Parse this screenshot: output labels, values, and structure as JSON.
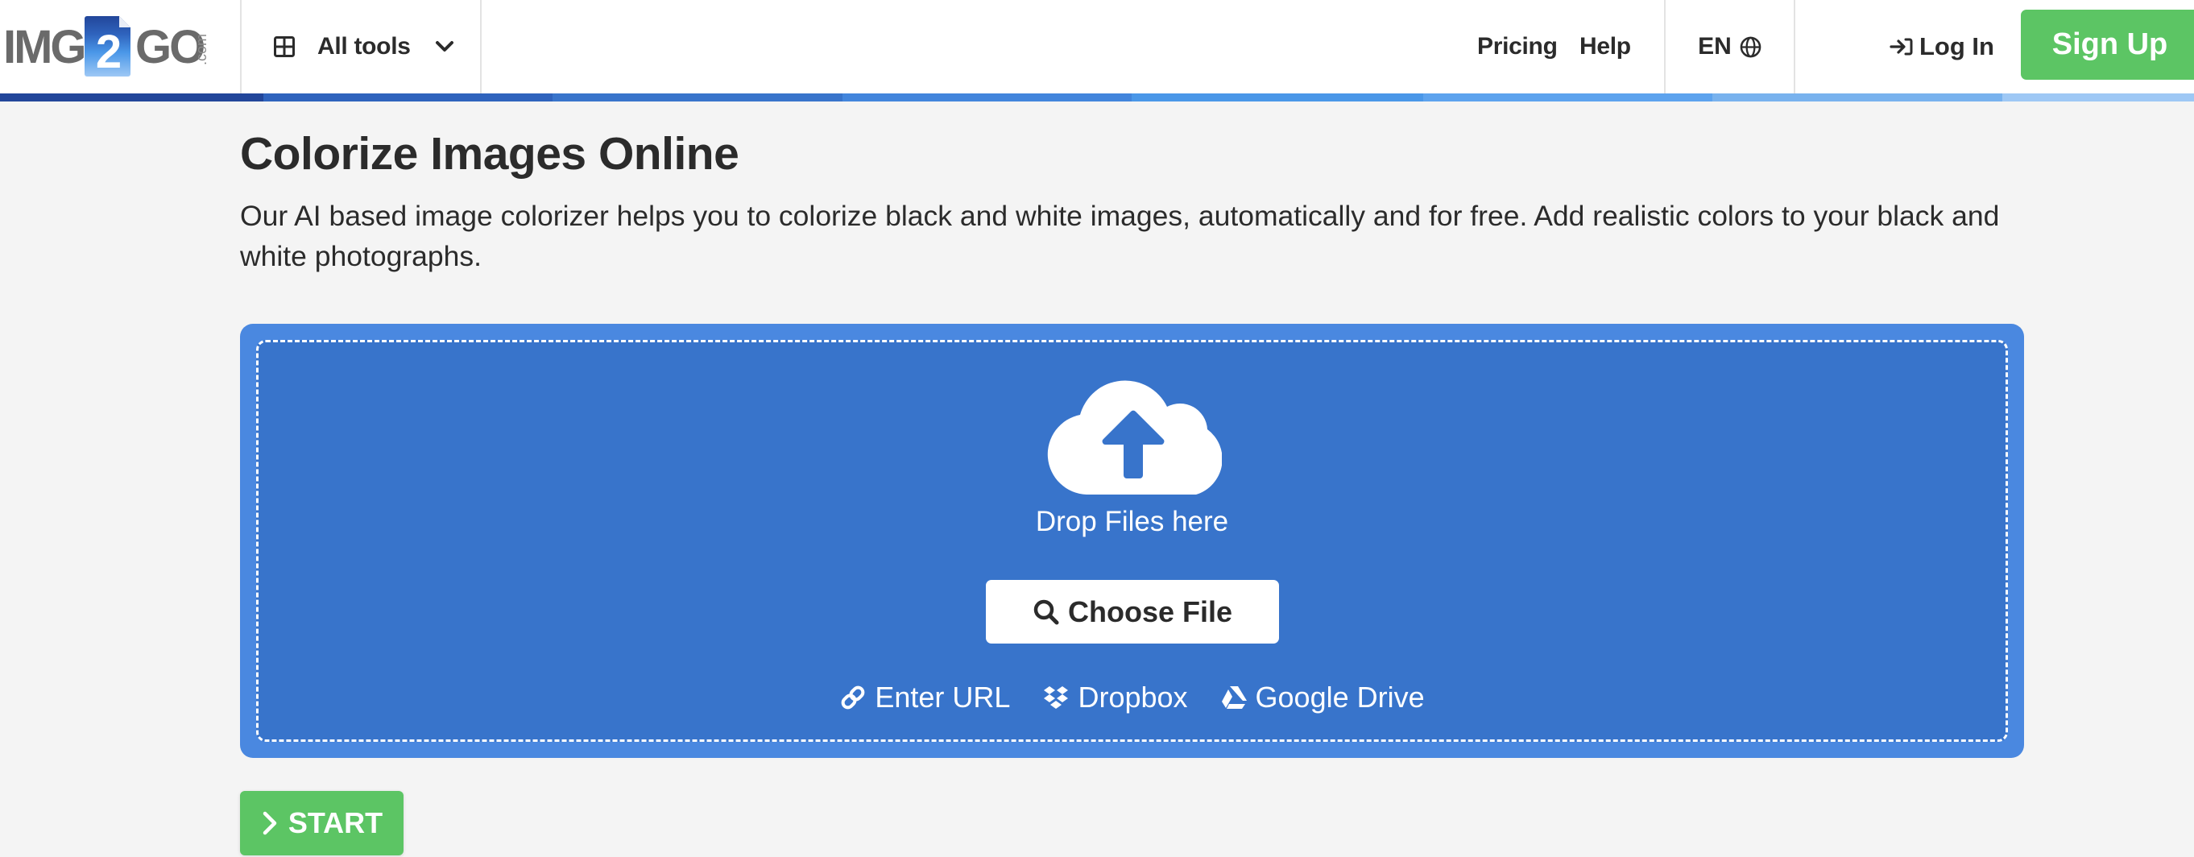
{
  "header": {
    "logo": {
      "left": "IMG",
      "badge": "2",
      "right": "GO",
      "suffix": ".com"
    },
    "all_tools_label": "All tools",
    "nav": [
      {
        "label": "Pricing"
      },
      {
        "label": "Help"
      }
    ],
    "language": "EN",
    "login_label": "Log In",
    "signup_label": "Sign Up",
    "stripe_colors": [
      "#22469a",
      "#2f63bd",
      "#3874cb",
      "#4285dc",
      "#4a97e8",
      "#5da3ee",
      "#78b2ee",
      "#9ec8f5"
    ]
  },
  "main": {
    "title": "Colorize Images Online",
    "description": "Our AI based image colorizer helps you to colorize black and white images, automatically and for free. Add realistic colors to your black and white photographs.",
    "upload": {
      "drop_label": "Drop Files here",
      "choose_label": "Choose File",
      "sources": [
        {
          "icon": "link-icon",
          "label": "Enter URL"
        },
        {
          "icon": "dropbox-icon",
          "label": "Dropbox"
        },
        {
          "icon": "google-drive-icon",
          "label": "Google Drive"
        }
      ]
    },
    "start_label": "START"
  },
  "colors": {
    "accent_green": "#5cc564",
    "upload_outer": "#4a88e0",
    "upload_inner": "#3874cb",
    "text": "#2b2b2b",
    "background": "#f4f4f4"
  }
}
